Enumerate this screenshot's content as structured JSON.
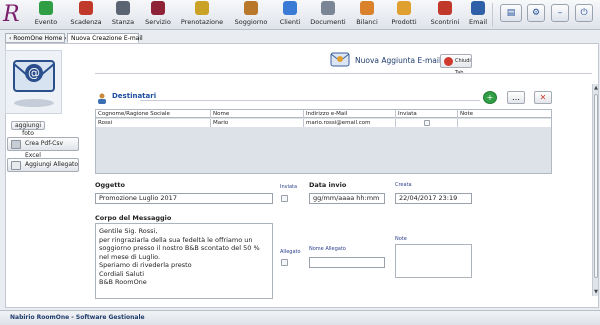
{
  "toolbar": {
    "logo_letter": "R",
    "buttons": [
      {
        "label": "Evento",
        "icon": "calendar-icon",
        "color": "#2f9e44"
      },
      {
        "label": "Scadenza",
        "icon": "deadline-icon",
        "color": "#c0392b"
      },
      {
        "label": "Stanza",
        "icon": "room-icon",
        "color": "#5a6472"
      },
      {
        "label": "Servizio",
        "icon": "service-icon",
        "color": "#8e2236"
      },
      {
        "label": "Prenotazione",
        "icon": "booking-icon",
        "color": "#c9a227"
      },
      {
        "label": "Soggiorno",
        "icon": "stay-icon",
        "color": "#b9772a"
      },
      {
        "label": "Clienti",
        "icon": "clients-icon",
        "color": "#3a7bd5"
      },
      {
        "label": "Documenti",
        "icon": "documents-icon",
        "color": "#7a8696"
      },
      {
        "label": "Bilanci",
        "icon": "balance-icon",
        "color": "#d9822b"
      },
      {
        "label": "Prodotti",
        "icon": "products-icon",
        "color": "#e0a030"
      },
      {
        "label": "Scontrini",
        "icon": "receipt-icon",
        "color": "#c0392b"
      },
      {
        "label": "Email",
        "icon": "email-icon",
        "color": "#2f5fa7"
      }
    ],
    "right_buttons": [
      {
        "icon": "printer-icon",
        "glyph": "▤"
      },
      {
        "icon": "settings-icon",
        "glyph": "⚙"
      },
      {
        "icon": "minimize-icon",
        "glyph": "–"
      },
      {
        "icon": "power-icon",
        "glyph": "⏻"
      }
    ]
  },
  "tabs": [
    {
      "label": "‹ RoomOne Home ›"
    },
    {
      "label": "Nuova Creazione E-mail"
    }
  ],
  "left": {
    "add_photo": "aggiungi foto",
    "create_pdf": "Crea Pdf-Csv Excel",
    "add_attachment": "Aggiungi Allegato"
  },
  "header": {
    "title": "Nuova Aggiunta E-mail",
    "close_label": "Chiudi Tab"
  },
  "recipients": {
    "section_title": "Destinatari",
    "actions": [
      {
        "icon": "add-icon",
        "glyph": "+"
      },
      {
        "icon": "edit-icon",
        "glyph": "…"
      },
      {
        "icon": "delete-icon",
        "glyph": "✕"
      }
    ],
    "columns": [
      "Cognome/Ragione Sociale",
      "Nome",
      "Indirizzo e-Mail",
      "Inviata",
      "Note"
    ],
    "rows": [
      {
        "cognome": "Rossi",
        "nome": "Mario",
        "email": "mario.rossi@email.com",
        "inviata": false,
        "note": ""
      }
    ]
  },
  "form": {
    "oggetto_label": "Oggetto",
    "oggetto_value": "Promozione Luglio 2017",
    "inviata_label": "Inviata",
    "data_invio_label": "Data invio",
    "data_invio_placeholder": "gg/mm/aaaa hh:mm",
    "creata_label": "Creata",
    "creata_value": "22/04/2017 23:19",
    "corpo_label": "Corpo del Messaggio",
    "corpo_lines": [
      "Gentile Sig. Rossi,",
      "per ringraziarla della sua fedeltà le offriamo un",
      "soggiorno presso il nostro B&B scontato del 50 %",
      "nel mese di Luglio.",
      "Speriamo di rivederla presto",
      "Cordiali Saluti",
      "B&B RoomOne"
    ],
    "allegato_label": "Allegato",
    "nome_allegato_label": "Nome Allegato",
    "note_label": "Note"
  },
  "status": {
    "text": "Nabirio RoomOne - Software Gestionale"
  }
}
